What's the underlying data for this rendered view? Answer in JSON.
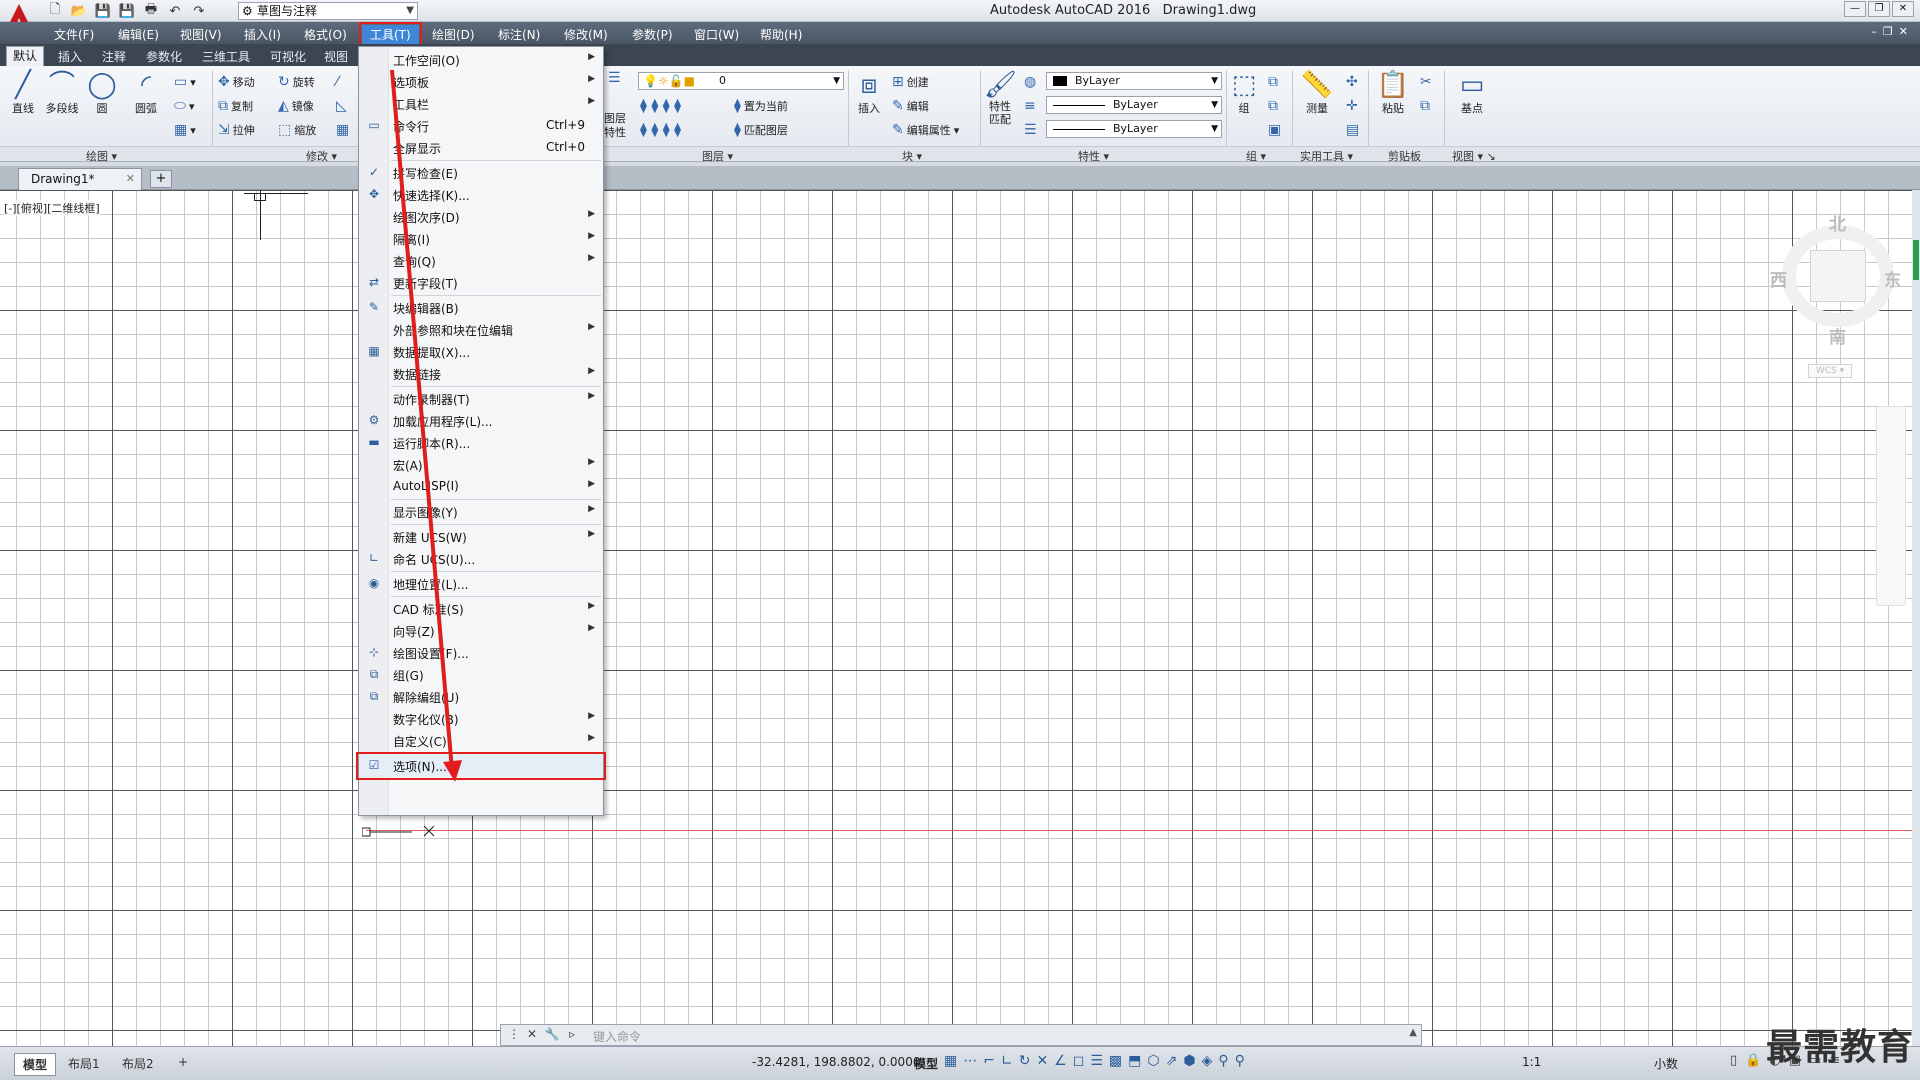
{
  "title_bar": {
    "app_title": "Autodesk AutoCAD 2016",
    "file_name": "Drawing1.dwg",
    "workspace": "草图与注释"
  },
  "menubar": {
    "items": [
      "文件(F)",
      "编辑(E)",
      "视图(V)",
      "插入(I)",
      "格式(O)",
      "工具(T)",
      "绘图(D)",
      "标注(N)",
      "修改(M)",
      "参数(P)",
      "窗口(W)",
      "帮助(H)"
    ],
    "active": "工具(T)"
  },
  "ribbon_tabs": [
    "默认",
    "插入",
    "注释",
    "参数化",
    "三维工具",
    "可视化",
    "视图"
  ],
  "ribbon": {
    "draw": {
      "line": "直线",
      "polyline": "多段线",
      "circle": "圆",
      "arc": "圆弧",
      "panel": "绘图"
    },
    "modify": {
      "move": "移动",
      "rotate": "旋转",
      "copy": "复制",
      "mirror": "镜像",
      "stretch": "拉伸",
      "scale": "缩放",
      "panel": "修改"
    },
    "layers": {
      "layer_props": "图层特性",
      "current_layer": "0",
      "make_current": "置为当前",
      "match_layer": "匹配图层",
      "panel": "图层"
    },
    "block": {
      "insert": "插入",
      "create": "创建",
      "edit": "编辑",
      "edit_attr": "编辑属性",
      "panel": "块"
    },
    "properties": {
      "match": "特性匹配",
      "color": "ByLayer",
      "linetype": "ByLayer",
      "lineweight": "ByLayer",
      "panel": "特性"
    },
    "groups": {
      "group": "组",
      "panel": "组"
    },
    "utilities": {
      "measure": "测量",
      "panel": "实用工具"
    },
    "clipboard": {
      "paste": "粘贴",
      "panel": "剪贴板"
    },
    "view": {
      "base": "基点",
      "panel": "视图"
    }
  },
  "doc_tab": {
    "name": "Drawing1*"
  },
  "viewport_label": "[-][俯视][二维线框]",
  "viewcube": {
    "north": "北",
    "south": "南",
    "east": "东",
    "west": "西",
    "wcs": "WCS"
  },
  "tools_menu": [
    {
      "label": "工作空间(O)",
      "submenu": true
    },
    {
      "label": "选项板",
      "submenu": true
    },
    {
      "label": "工具栏",
      "submenu": true
    },
    {
      "label": "命令行",
      "shortcut": "Ctrl+9",
      "icon": "command-line-icon"
    },
    {
      "label": "全屏显示",
      "shortcut": "Ctrl+0"
    },
    {
      "sep": true
    },
    {
      "label": "拼写检查(E)",
      "icon": "spellcheck-icon"
    },
    {
      "label": "快速选择(K)...",
      "icon": "quick-select-icon"
    },
    {
      "label": "绘图次序(D)",
      "submenu": true
    },
    {
      "label": "隔离(I)",
      "submenu": true
    },
    {
      "label": "查询(Q)",
      "submenu": true
    },
    {
      "label": "更新字段(T)",
      "icon": "update-field-icon"
    },
    {
      "sep": true
    },
    {
      "label": "块编辑器(B)",
      "icon": "block-editor-icon"
    },
    {
      "label": "外部参照和块在位编辑",
      "submenu": true
    },
    {
      "label": "数据提取(X)...",
      "icon": "data-extract-icon"
    },
    {
      "label": "数据链接",
      "submenu": true
    },
    {
      "sep": true
    },
    {
      "label": "动作录制器(T)",
      "submenu": true
    },
    {
      "label": "加载应用程序(L)...",
      "icon": "load-app-icon"
    },
    {
      "label": "运行脚本(R)...",
      "icon": "run-script-icon"
    },
    {
      "label": "宏(A)",
      "submenu": true
    },
    {
      "label": "AutoLISP(I)",
      "submenu": true
    },
    {
      "sep": true
    },
    {
      "label": "显示图像(Y)",
      "submenu": true
    },
    {
      "sep": true
    },
    {
      "label": "新建 UCS(W)",
      "submenu": true
    },
    {
      "label": "命名 UCS(U)...",
      "icon": "named-ucs-icon"
    },
    {
      "sep": true
    },
    {
      "label": "地理位置(L)...",
      "icon": "geo-location-icon"
    },
    {
      "sep": true
    },
    {
      "label": "CAD 标准(S)",
      "submenu": true
    },
    {
      "label": "向导(Z)",
      "submenu": true
    },
    {
      "label": "绘图设置(F)...",
      "icon": "drafting-settings-icon"
    },
    {
      "label": "组(G)",
      "icon": "group-icon"
    },
    {
      "label": "解除编组(U)",
      "icon": "ungroup-icon"
    },
    {
      "label": "数字化仪(B)",
      "submenu": true
    },
    {
      "label": "自定义(C)",
      "submenu": true
    },
    {
      "sep": true
    },
    {
      "label": "选项(N)...",
      "icon": "options-icon",
      "highlight": true
    }
  ],
  "command_line": {
    "placeholder": "键入命令"
  },
  "layout_tabs": [
    "模型",
    "布局1",
    "布局2"
  ],
  "status": {
    "coords": "-32.4281, 198.8802, 0.0000",
    "model": "模型",
    "scale": "1:1",
    "units": "小数"
  },
  "watermark": "最需教育",
  "colors": {
    "accent": "#3f86d8",
    "highlight_red": "#e01e1e"
  }
}
